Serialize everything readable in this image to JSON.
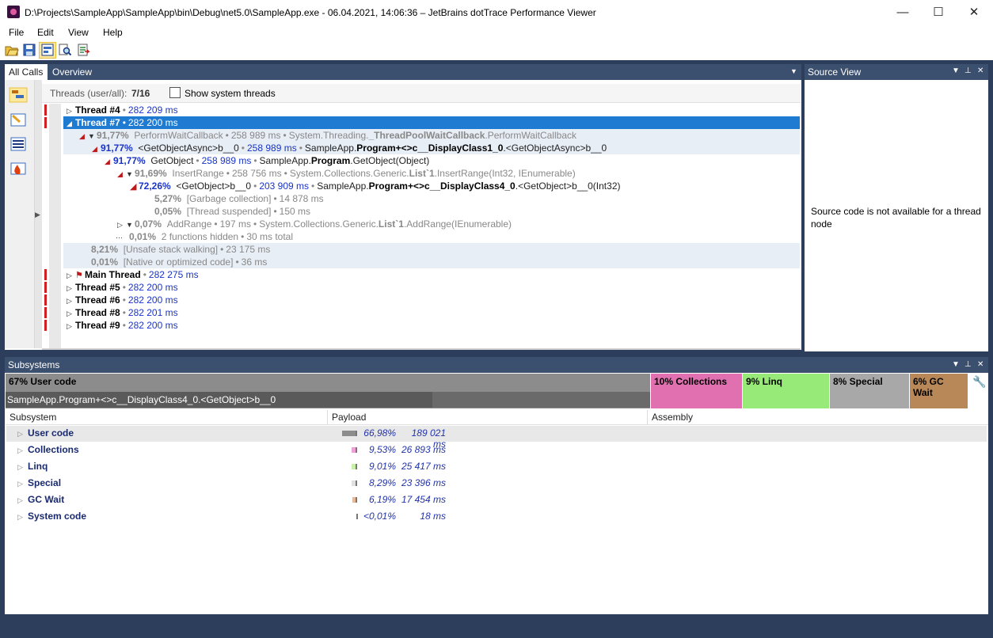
{
  "window": {
    "title": "D:\\Projects\\SampleApp\\SampleApp\\bin\\Debug\\net5.0\\SampleApp.exe - 06.04.2021, 14:06:36 – JetBrains dotTrace Performance Viewer",
    "minimize": "—",
    "maximize": "☐",
    "close": "✕"
  },
  "menu": [
    "File",
    "Edit",
    "View",
    "Help"
  ],
  "tabs": {
    "all_calls": "All Calls",
    "overview": "Overview"
  },
  "threads_bar": {
    "label": "Threads (user/all):",
    "count": "7/16",
    "show_system": "Show system threads"
  },
  "tree": {
    "thread4": {
      "name": "Thread #4",
      "time": "282 209 ms"
    },
    "thread7": {
      "name": "Thread #7",
      "time": "282 200 ms"
    },
    "r1": {
      "pct": "91,77%",
      "name": "PerformWaitCallback",
      "time": "258 989 ms",
      "ns": "System.Threading.",
      "cls": "_ThreadPoolWaitCallback",
      "meth": ".PerformWaitCallback"
    },
    "r2": {
      "pct": "91,77%",
      "name": "<GetObjectAsync>b__0",
      "time": "258 989 ms",
      "ns": "SampleApp.",
      "cls": "Program+<>c__DisplayClass1_0",
      "meth": ".<GetObjectAsync>b__0"
    },
    "r3": {
      "pct": "91,77%",
      "name": "GetObject",
      "time": "258 989 ms",
      "ns": "SampleApp.",
      "cls": "Program",
      "meth": ".GetObject(Object)"
    },
    "r4": {
      "pct": "91,69%",
      "name": "InsertRange",
      "time": "258 756 ms",
      "ns": "System.Collections.Generic.",
      "cls": "List`1",
      "meth": ".InsertRange(Int32, IEnumerable)"
    },
    "r5": {
      "pct": "72,26%",
      "name": "<GetObject>b__0",
      "time": "203 909 ms",
      "ns": "SampleApp.",
      "cls": "Program+<>c__DisplayClass4_0",
      "meth": ".<GetObject>b__0(Int32)"
    },
    "r6": {
      "pct": "5,27%",
      "name": "[Garbage collection]",
      "time": "14 878 ms"
    },
    "r7": {
      "pct": "0,05%",
      "name": "[Thread suspended]",
      "time": "150 ms"
    },
    "r8": {
      "pct": "0,07%",
      "name": "AddRange",
      "time": "197 ms",
      "ns": "System.Collections.Generic.",
      "cls": "List`1",
      "meth": ".AddRange(IEnumerable)"
    },
    "r9": {
      "pct": "0,01%",
      "name": "2 functions hidden",
      "time": "30 ms total"
    },
    "r10": {
      "pct": "8,21%",
      "name": "[Unsafe stack walking]",
      "time": "23 175 ms"
    },
    "r11": {
      "pct": "0,01%",
      "name": "[Native or optimized code]",
      "time": "36 ms"
    },
    "main": {
      "name": "Main Thread",
      "time": "282 275 ms"
    },
    "thread5": {
      "name": "Thread #5",
      "time": "282 200 ms"
    },
    "thread6": {
      "name": "Thread #6",
      "time": "282 200 ms"
    },
    "thread8": {
      "name": "Thread #8",
      "time": "282 201 ms"
    },
    "thread9": {
      "name": "Thread #9",
      "time": "282 200 ms"
    }
  },
  "source_view": {
    "title": "Source View",
    "message": "Source code is not available for a thread node"
  },
  "subsystems": {
    "title": "Subsystems",
    "bars": {
      "user": "67% User code",
      "user_sub": "SampleApp.Program+<>c__DisplayClass4_0.<GetObject>b__0",
      "collections": "10% Collections",
      "linq": "9% Linq",
      "special": "8% Special",
      "gc": "6% GC Wait"
    },
    "columns": {
      "subsystem": "Subsystem",
      "payload": "Payload",
      "assembly": "Assembly"
    },
    "rows": [
      {
        "name": "User code",
        "pct": "66,98%",
        "ms": "189 021 ms",
        "share": 0.6698,
        "color": "#8c8c8c"
      },
      {
        "name": "Collections",
        "pct": "9,53%",
        "ms": "26 893 ms",
        "share": 0.0953,
        "color": "#f0a0d8"
      },
      {
        "name": "Linq",
        "pct": "9,01%",
        "ms": "25 417 ms",
        "share": 0.0901,
        "color": "#c8f0a8"
      },
      {
        "name": "Special",
        "pct": "8,29%",
        "ms": "23 396 ms",
        "share": 0.0829,
        "color": "#e0e0e0"
      },
      {
        "name": "GC Wait",
        "pct": "6,19%",
        "ms": "17 454 ms",
        "share": 0.0619,
        "color": "#f0b890"
      },
      {
        "name": "System code",
        "pct": "<0,01%",
        "ms": "18 ms",
        "share": 0.0001,
        "color": "#bbbbbb"
      }
    ]
  }
}
